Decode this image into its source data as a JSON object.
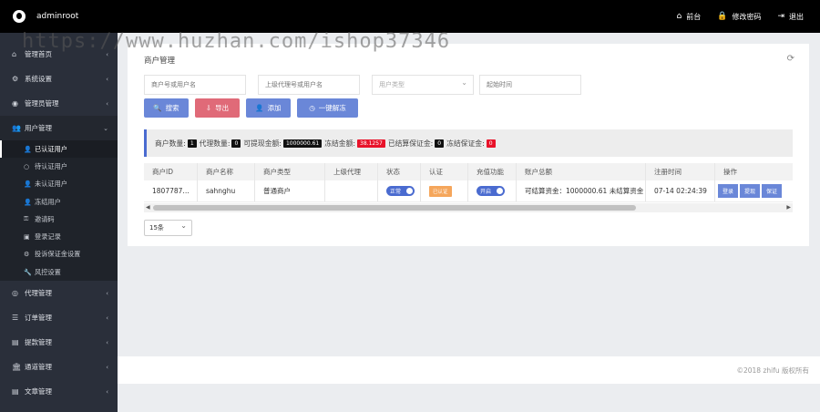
{
  "header": {
    "username": "adminroot",
    "actions": [
      {
        "icon": "home-icon",
        "glyph": "⌂",
        "label": "前台"
      },
      {
        "icon": "lock-icon",
        "glyph": "🔒",
        "label": "修改密码"
      },
      {
        "icon": "logout-icon",
        "glyph": "⇥",
        "label": "退出"
      }
    ]
  },
  "sidebar": {
    "items": [
      {
        "icon": "home-icon",
        "glyph": "⌂",
        "label": "管理首页",
        "chevron": "‹"
      },
      {
        "icon": "gears-icon",
        "glyph": "⚙",
        "label": "系统设置",
        "chevron": "‹"
      },
      {
        "icon": "admin-icon",
        "glyph": "◉",
        "label": "管理员管理",
        "chevron": "‹"
      },
      {
        "icon": "users-icon",
        "glyph": "👥",
        "label": "用户管理",
        "chevron": "⌄"
      }
    ],
    "sub_items": [
      {
        "icon": "user-icon",
        "glyph": "👤",
        "label": "已认证用户"
      },
      {
        "icon": "user-outline-icon",
        "glyph": "○",
        "label": "待认证用户"
      },
      {
        "icon": "user-x-icon",
        "glyph": "👤",
        "label": "未认证用户"
      },
      {
        "icon": "user-lock-icon",
        "glyph": "👤",
        "label": "冻结用户"
      },
      {
        "icon": "key-icon",
        "glyph": "⚿",
        "label": "邀请码"
      },
      {
        "icon": "record-icon",
        "glyph": "▣",
        "label": "登录记录"
      },
      {
        "icon": "deposit-icon",
        "glyph": "⚙",
        "label": "投诉保证金设置"
      },
      {
        "icon": "wrench-icon",
        "glyph": "🔧",
        "label": "风控设置"
      }
    ],
    "bottom_items": [
      {
        "icon": "eye-icon",
        "glyph": "◎",
        "label": "代理管理",
        "chevron": "‹"
      },
      {
        "icon": "list-icon",
        "glyph": "☰",
        "label": "订单管理",
        "chevron": "‹"
      },
      {
        "icon": "withdraw-icon",
        "glyph": "▤",
        "label": "提款管理",
        "chevron": "‹"
      },
      {
        "icon": "bank-icon",
        "glyph": "🏛",
        "label": "通道管理",
        "chevron": "‹"
      },
      {
        "icon": "article-icon",
        "glyph": "▤",
        "label": "文章管理",
        "chevron": "‹"
      }
    ]
  },
  "main": {
    "title": "商户管理",
    "filters": {
      "merchant_placeholder": "商户号或用户名",
      "agent_placeholder": "上级代理号或用户名",
      "type_placeholder": "用户类型",
      "start_placeholder": "起始时间"
    },
    "buttons": {
      "search": "搜索",
      "export": "导出",
      "add": "添加",
      "unfreeze": "一键解冻"
    },
    "stats": {
      "merchant_count_label": "商户数量:",
      "merchant_count": "1",
      "agent_count_label": "代理数量:",
      "agent_count": "0",
      "withdrawable_label": "可提现金额:",
      "withdrawable": "1000000.61",
      "frozen_label": "冻结金额:",
      "frozen": "38.1257",
      "settled_deposit_label": "已结算保证金:",
      "settled_deposit": "0",
      "frozen_deposit_label": "冻结保证金:",
      "frozen_deposit": "0"
    },
    "table": {
      "headers": [
        "商户ID",
        "商户名称",
        "商户类型",
        "上级代理",
        "状态",
        "认证",
        "充值功能",
        "账户总额",
        "注册时间",
        "操作"
      ],
      "row": {
        "id": "1807787…",
        "name": "sahnghu",
        "type": "普通商户",
        "agent": "",
        "status": "正常",
        "auth": "已认证",
        "recharge": "开启",
        "balance": "可结算资金：1000000.61 未结算资金",
        "reg_time": "07-14 02:24:39",
        "ops": [
          "登录",
          "提现",
          "保证"
        ]
      }
    },
    "pager": "15条"
  },
  "footer": {
    "copyright": "©2018 zhifu 版权所有"
  },
  "watermark": "https://www.huzhan.com/ishop37346"
}
